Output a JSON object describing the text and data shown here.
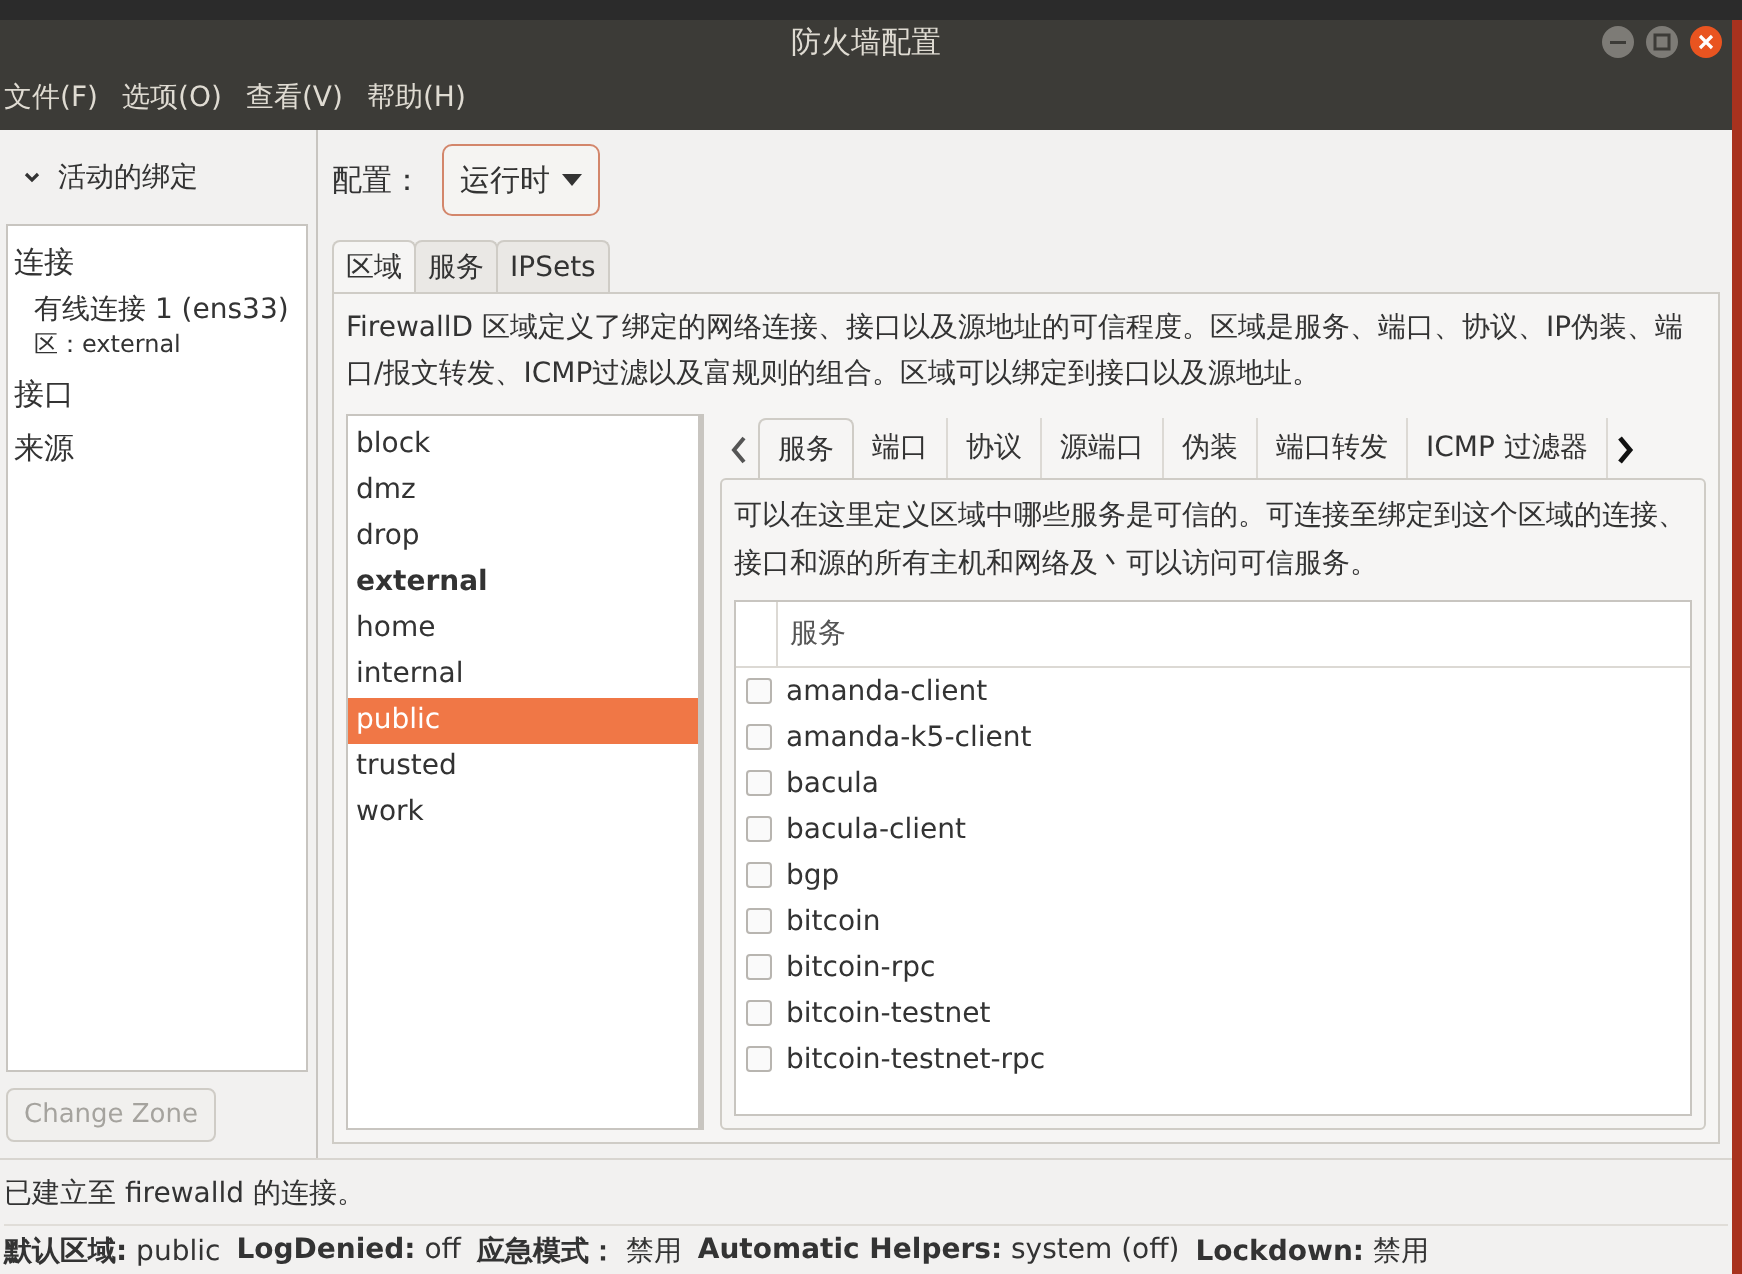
{
  "window": {
    "title": "防火墙配置"
  },
  "menu": [
    "文件(F)",
    "选项(O)",
    "查看(V)",
    "帮助(H)"
  ],
  "sidebar": {
    "header": "活动的绑定",
    "expanded": true,
    "sections": [
      {
        "label": "连接",
        "children": [
          {
            "label": "有线连接 1 (ens33)",
            "zone": "区：external"
          }
        ]
      },
      {
        "label": "接口"
      },
      {
        "label": "来源"
      }
    ],
    "button": {
      "label": "Change Zone",
      "disabled": true
    }
  },
  "config": {
    "label": "配置：",
    "value": "运行时"
  },
  "tabs": [
    {
      "label": "区域",
      "selected": true
    },
    {
      "label": "服务",
      "selected": false
    },
    {
      "label": "IPSets",
      "selected": false
    }
  ],
  "description": "FirewallD 区域定义了绑定的网络连接、接口以及源地址的可信程度。区域是服务、端口、协议、IP伪装、端口/报文转发、ICMP过滤以及富规则的组合。区域可以绑定到接口以及源地址。",
  "zones": [
    {
      "name": "block",
      "selected": false,
      "active": false
    },
    {
      "name": "dmz",
      "selected": false,
      "active": false
    },
    {
      "name": "drop",
      "selected": false,
      "active": false
    },
    {
      "name": "external",
      "selected": false,
      "active": true
    },
    {
      "name": "home",
      "selected": false,
      "active": false
    },
    {
      "name": "internal",
      "selected": false,
      "active": false
    },
    {
      "name": "public",
      "selected": true,
      "active": false
    },
    {
      "name": "trusted",
      "selected": false,
      "active": false
    },
    {
      "name": "work",
      "selected": false,
      "active": false
    }
  ],
  "zone_tabs": [
    {
      "label": "服务",
      "selected": true
    },
    {
      "label": "端口",
      "selected": false
    },
    {
      "label": "协议",
      "selected": false
    },
    {
      "label": "源端口",
      "selected": false
    },
    {
      "label": "伪装",
      "selected": false
    },
    {
      "label": "端口转发",
      "selected": false
    },
    {
      "label": "ICMP 过滤器",
      "selected": false
    }
  ],
  "services_description": "可以在这里定义区域中哪些服务是可信的。可连接至绑定到这个区域的连接、接口和源的所有主机和网络及丶可以访问可信服务。",
  "services_table": {
    "columns": [
      "服务"
    ],
    "rows": [
      {
        "name": "amanda-client",
        "checked": false
      },
      {
        "name": "amanda-k5-client",
        "checked": false
      },
      {
        "name": "bacula",
        "checked": false
      },
      {
        "name": "bacula-client",
        "checked": false
      },
      {
        "name": "bgp",
        "checked": false
      },
      {
        "name": "bitcoin",
        "checked": false
      },
      {
        "name": "bitcoin-rpc",
        "checked": false
      },
      {
        "name": "bitcoin-testnet",
        "checked": false
      },
      {
        "name": "bitcoin-testnet-rpc",
        "checked": false
      }
    ]
  },
  "status_bar": {
    "message": "已建立至 firewalld 的连接。",
    "items": [
      {
        "label": "默认区域:",
        "value": "public"
      },
      {
        "label": "LogDenied:",
        "value": "off"
      },
      {
        "label": "应急模式：",
        "value": "禁用"
      },
      {
        "label": "Automatic Helpers:",
        "value": "system (off)"
      },
      {
        "label": "Lockdown:",
        "value": "禁用"
      }
    ]
  }
}
